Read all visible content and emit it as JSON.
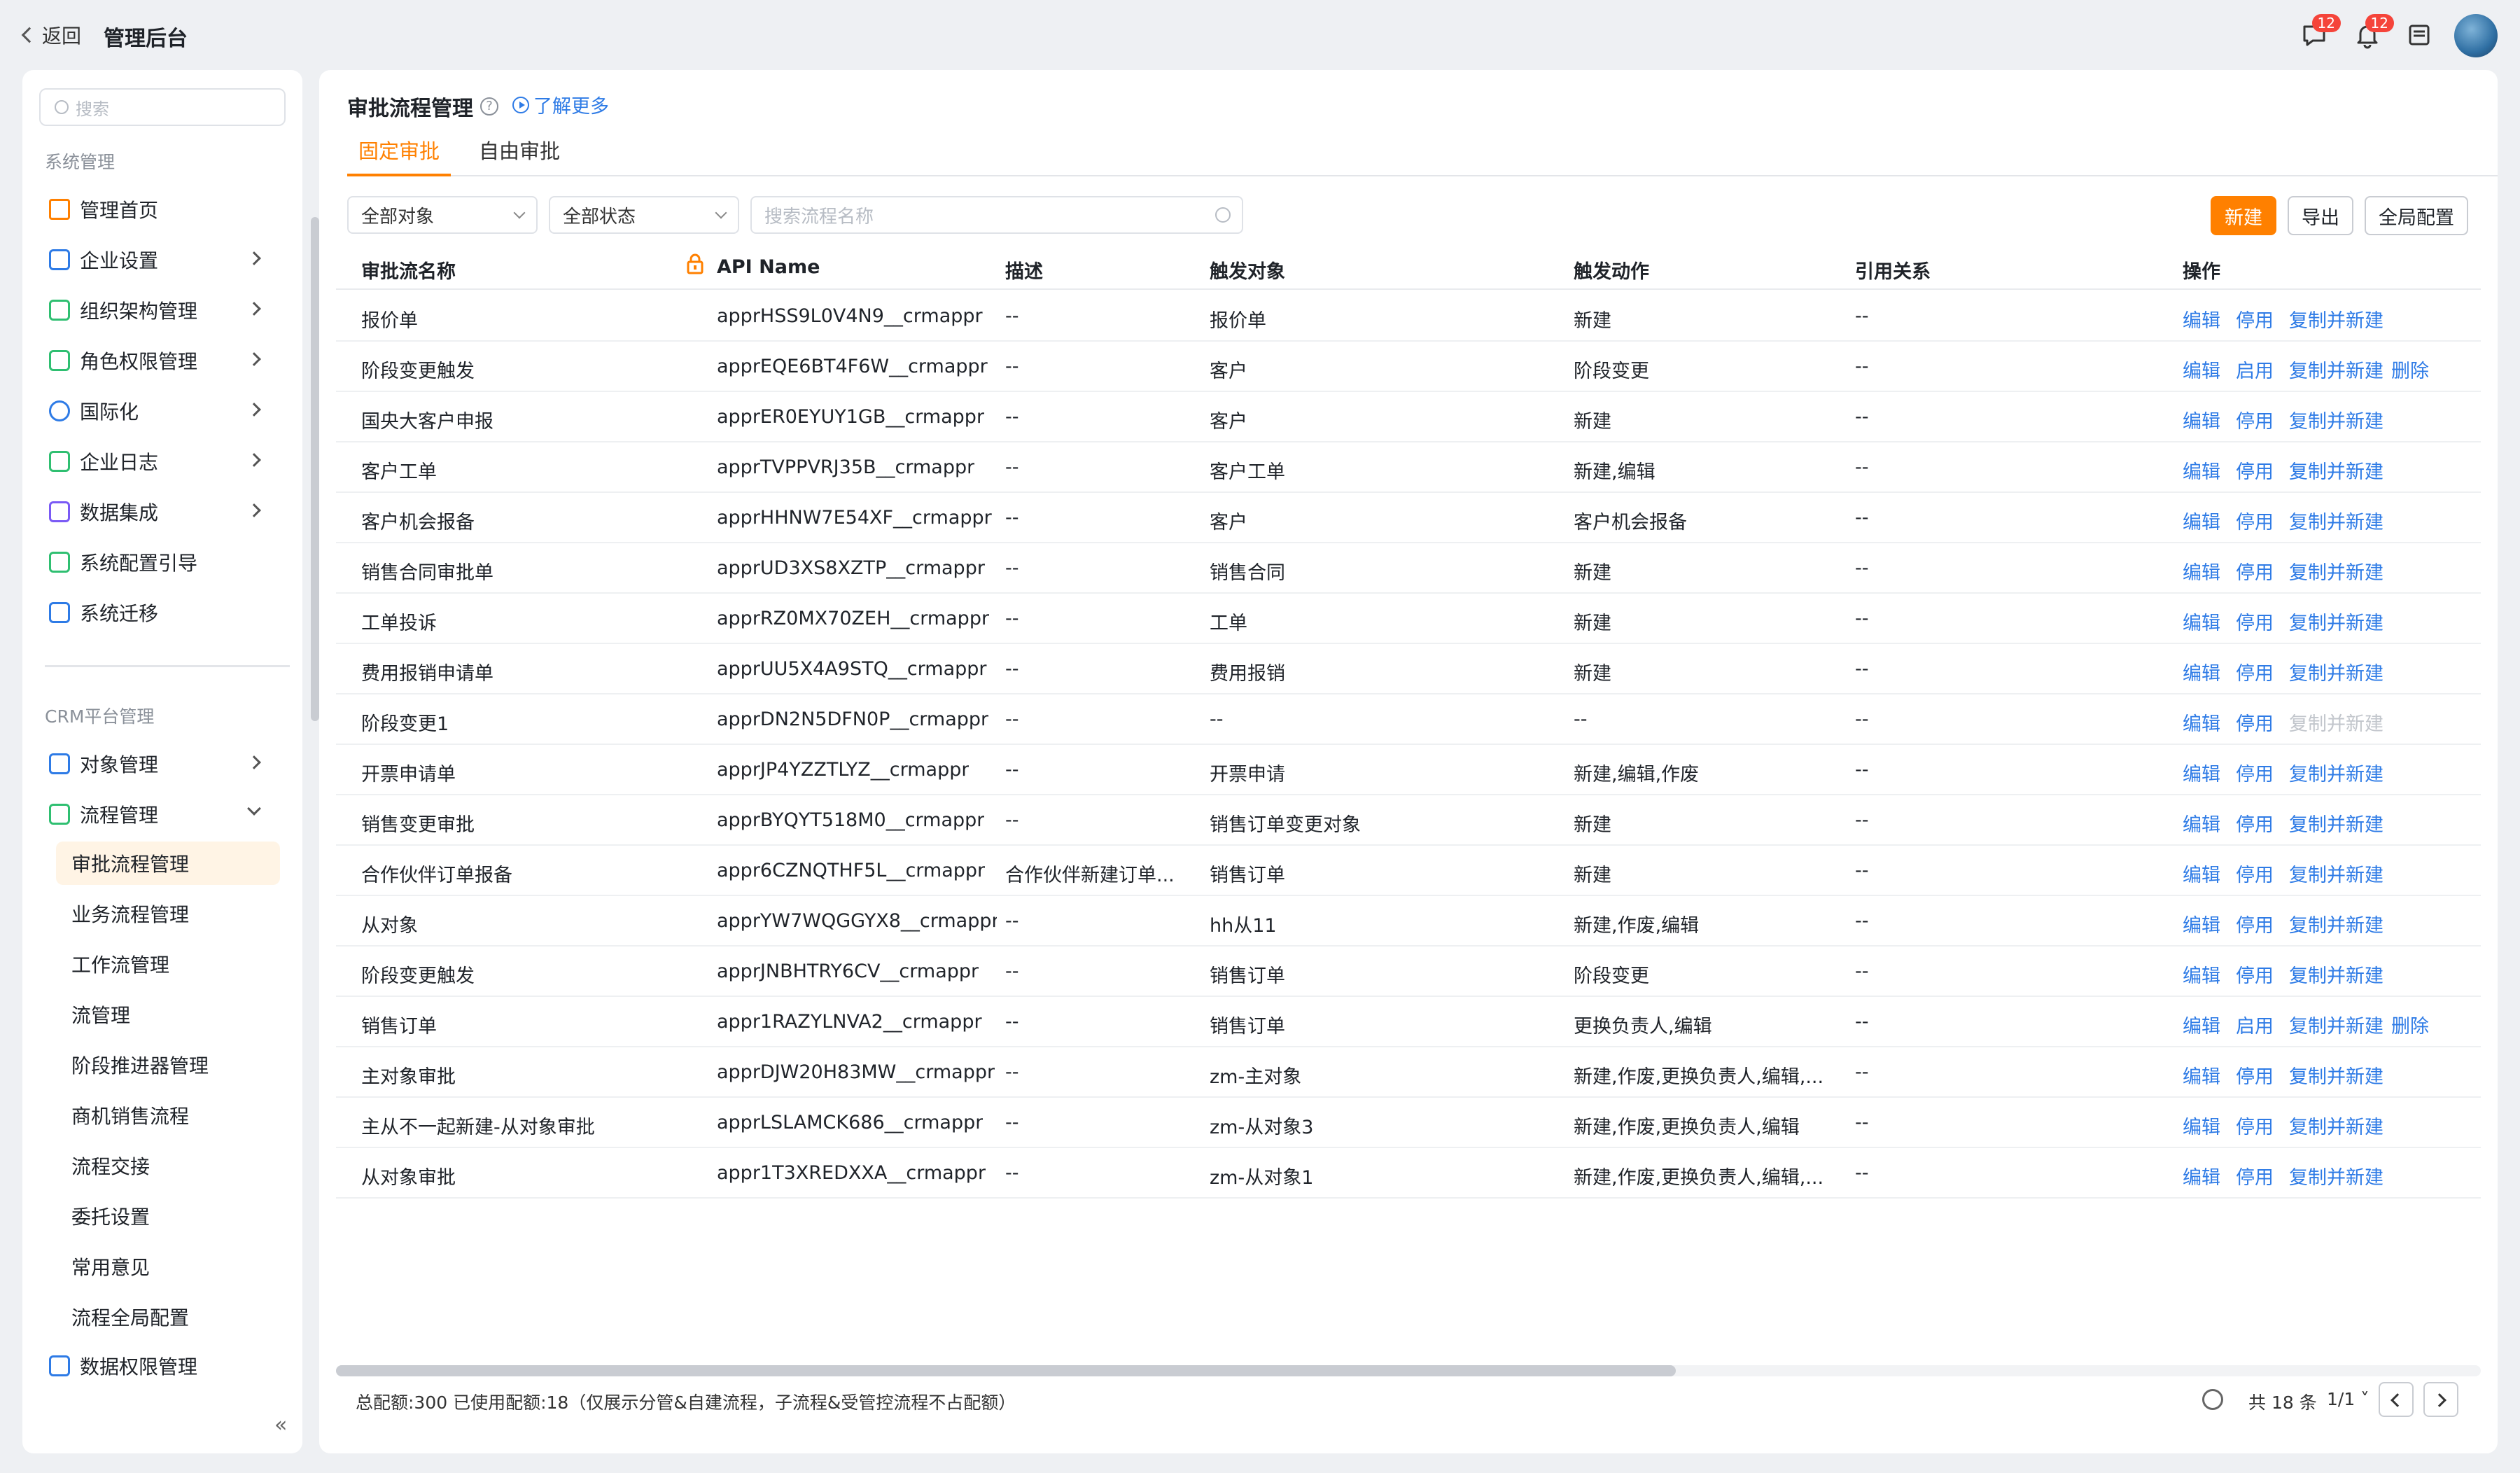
{
  "topbar": {
    "back_label": "返回",
    "title": "管理后台",
    "chat_badge": "12",
    "bell_badge": "12"
  },
  "sidebar": {
    "search_placeholder": "搜索",
    "section1": "系统管理",
    "items1": [
      {
        "label": "管理首页",
        "icon": "home-icon",
        "arrow": false
      },
      {
        "label": "企业设置",
        "icon": "enterprise-icon",
        "arrow": true
      },
      {
        "label": "组织架构管理",
        "icon": "org-chart-icon",
        "arrow": true
      },
      {
        "label": "角色权限管理",
        "icon": "role-icon",
        "arrow": true
      },
      {
        "label": "国际化",
        "icon": "globe-icon",
        "arrow": true
      },
      {
        "label": "企业日志",
        "icon": "log-icon",
        "arrow": true
      },
      {
        "label": "数据集成",
        "icon": "chip-icon",
        "arrow": true
      },
      {
        "label": "系统配置引导",
        "icon": "signpost-icon",
        "arrow": false
      },
      {
        "label": "系统迁移",
        "icon": "migrate-icon",
        "arrow": false
      }
    ],
    "section2": "CRM平台管理",
    "items2": [
      {
        "label": "对象管理",
        "icon": "object-icon",
        "arrow": true
      },
      {
        "label": "流程管理",
        "icon": "flow-icon",
        "arrow": true,
        "expanded": true
      }
    ],
    "sub_items": [
      "审批流程管理",
      "业务流程管理",
      "工作流管理",
      "流管理",
      "阶段推进器管理",
      "商机销售流程",
      "流程交接",
      "委托设置",
      "常用意见",
      "流程全局配置"
    ],
    "last_item": "数据权限管理"
  },
  "main": {
    "title": "审批流程管理",
    "learn_more": "了解更多",
    "tabs": [
      "固定审批",
      "自由审批"
    ],
    "filters": {
      "object": "全部对象",
      "status": "全部状态",
      "search_placeholder": "搜索流程名称"
    },
    "buttons": {
      "new": "新建",
      "export": "导出",
      "global": "全局配置"
    },
    "columns": [
      "审批流名称",
      "API Name",
      "描述",
      "触发对象",
      "触发动作",
      "引用关系",
      "操作"
    ],
    "rows": [
      {
        "name": "报价单",
        "api": "apprHSS9L0V4N9__crmappr",
        "desc": "--",
        "target": "报价单",
        "action": "新建",
        "ref": "--",
        "ops": [
          "编辑",
          "停用",
          "复制并新建"
        ]
      },
      {
        "name": "阶段变更触发",
        "api": "apprEQE6BT4F6W__crmappr",
        "desc": "--",
        "target": "客户",
        "action": "阶段变更",
        "ref": "--",
        "ops": [
          "编辑",
          "启用",
          "复制并新建",
          "删除"
        ]
      },
      {
        "name": "国央大客户申报",
        "api": "apprER0EYUY1GB__crmappr",
        "desc": "--",
        "target": "客户",
        "action": "新建",
        "ref": "--",
        "ops": [
          "编辑",
          "停用",
          "复制并新建"
        ]
      },
      {
        "name": "客户工单",
        "api": "apprTVPPVRJ35B__crmappr",
        "desc": "--",
        "target": "客户工单",
        "action": "新建,编辑",
        "ref": "--",
        "ops": [
          "编辑",
          "停用",
          "复制并新建"
        ]
      },
      {
        "name": "客户机会报备",
        "api": "apprHHNW7E54XF__crmappr",
        "desc": "--",
        "target": "客户",
        "action": "客户机会报备",
        "ref": "--",
        "ops": [
          "编辑",
          "停用",
          "复制并新建"
        ]
      },
      {
        "name": "销售合同审批单",
        "api": "apprUD3XS8XZTP__crmappr",
        "desc": "--",
        "target": "销售合同",
        "action": "新建",
        "ref": "--",
        "ops": [
          "编辑",
          "停用",
          "复制并新建"
        ]
      },
      {
        "name": "工单投诉",
        "api": "apprRZ0MX70ZEH__crmappr",
        "desc": "--",
        "target": "工单",
        "action": "新建",
        "ref": "--",
        "ops": [
          "编辑",
          "停用",
          "复制并新建"
        ]
      },
      {
        "name": "费用报销申请单",
        "api": "apprUU5X4A9STQ__crmappr",
        "desc": "--",
        "target": "费用报销",
        "action": "新建",
        "ref": "--",
        "ops": [
          "编辑",
          "停用",
          "复制并新建"
        ]
      },
      {
        "name": "阶段变更1",
        "api": "apprDN2N5DFN0P__crmappr",
        "desc": "--",
        "target": "--",
        "action": "--",
        "ref": "--",
        "ops": [
          "编辑",
          "停用",
          "复制并新建"
        ],
        "copy_disabled": true
      },
      {
        "name": "开票申请单",
        "api": "apprJP4YZZTLYZ__crmappr",
        "desc": "--",
        "target": "开票申请",
        "action": "新建,编辑,作废",
        "ref": "--",
        "ops": [
          "编辑",
          "停用",
          "复制并新建"
        ]
      },
      {
        "name": "销售变更审批",
        "api": "apprBYQYT518M0__crmappr",
        "desc": "--",
        "target": "销售订单变更对象",
        "action": "新建",
        "ref": "--",
        "ops": [
          "编辑",
          "停用",
          "复制并新建"
        ]
      },
      {
        "name": "合作伙伴订单报备",
        "api": "appr6CZNQTHF5L__crmappr",
        "desc": "合作伙伴新建订单...",
        "target": "销售订单",
        "action": "新建",
        "ref": "--",
        "ops": [
          "编辑",
          "停用",
          "复制并新建"
        ]
      },
      {
        "name": "从对象",
        "api": "apprYW7WQGGYX8__crmappr",
        "desc": "--",
        "target": "hh从11",
        "action": "新建,作废,编辑",
        "ref": "--",
        "ops": [
          "编辑",
          "停用",
          "复制并新建"
        ]
      },
      {
        "name": "阶段变更触发",
        "api": "apprJNBHTRY6CV__crmappr",
        "desc": "--",
        "target": "销售订单",
        "action": "阶段变更",
        "ref": "--",
        "ops": [
          "编辑",
          "停用",
          "复制并新建"
        ]
      },
      {
        "name": "销售订单",
        "api": "appr1RAZYLNVA2__crmappr",
        "desc": "--",
        "target": "销售订单",
        "action": "更换负责人,编辑",
        "ref": "--",
        "ops": [
          "编辑",
          "启用",
          "复制并新建",
          "删除"
        ]
      },
      {
        "name": "主对象审批",
        "api": "apprDJW20H83MW__crmappr",
        "desc": "--",
        "target": "zm-主对象",
        "action": "新建,作废,更换负责人,编辑,...",
        "ref": "--",
        "ops": [
          "编辑",
          "停用",
          "复制并新建"
        ]
      },
      {
        "name": "主从不一起新建-从对象审批",
        "api": "apprLSLAMCK686__crmappr",
        "desc": "--",
        "target": "zm-从对象3",
        "action": "新建,作废,更换负责人,编辑",
        "ref": "--",
        "ops": [
          "编辑",
          "停用",
          "复制并新建"
        ]
      },
      {
        "name": "从对象审批",
        "api": "appr1T3XREDXXA__crmappr",
        "desc": "--",
        "target": "zm-从对象1",
        "action": "新建,作废,更换负责人,编辑,...",
        "ref": "--",
        "ops": [
          "编辑",
          "停用",
          "复制并新建"
        ]
      }
    ],
    "footer": {
      "note": "总配额:300 已使用配额:18（仅展示分管&自建流程，子流程&受管控流程不占配额）",
      "total": "共 18 条",
      "page": "1/1"
    }
  },
  "colors": {
    "accent": "#ff8000",
    "link": "#2e7be6"
  }
}
